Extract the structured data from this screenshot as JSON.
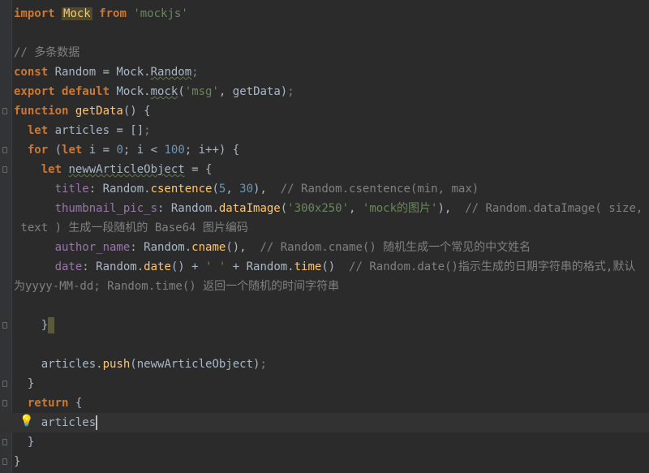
{
  "editor": {
    "lines": [
      [
        {
          "t": "import ",
          "c": "kw"
        },
        {
          "t": "Mock",
          "c": "mockhl"
        },
        {
          "t": " ",
          "c": ""
        },
        {
          "t": "from",
          "c": "kw"
        },
        {
          "t": " 'mockjs'",
          "c": "str"
        }
      ],
      [],
      [
        {
          "t": "// 多条数据",
          "c": "cm"
        }
      ],
      [
        {
          "t": "const ",
          "c": "kw"
        },
        {
          "t": "Random = Mock.",
          "c": ""
        },
        {
          "t": "Random",
          "c": "squig"
        },
        {
          "t": ";",
          "c": "cm"
        }
      ],
      [
        {
          "t": "export ",
          "c": "kw"
        },
        {
          "t": "default ",
          "c": "kw"
        },
        {
          "t": "Mock.",
          "c": ""
        },
        {
          "t": "mock",
          "c": "squig"
        },
        {
          "t": "(",
          "c": ""
        },
        {
          "t": "'msg'",
          "c": "str"
        },
        {
          "t": ", getData)",
          "c": ""
        },
        {
          "t": ";",
          "c": "cm"
        }
      ],
      [
        {
          "t": "function ",
          "c": "kw"
        },
        {
          "t": "getData",
          "c": "fn"
        },
        {
          "t": "() {",
          "c": ""
        }
      ],
      [
        {
          "t": "  let ",
          "c": "kw"
        },
        {
          "t": "articles = []",
          "c": ""
        },
        {
          "t": ";",
          "c": "cm"
        }
      ],
      [
        {
          "t": "  for ",
          "c": "kw"
        },
        {
          "t": "(",
          "c": ""
        },
        {
          "t": "let ",
          "c": "kw"
        },
        {
          "t": "i = ",
          "c": ""
        },
        {
          "t": "0",
          "c": "num"
        },
        {
          "t": "; i < ",
          "c": ""
        },
        {
          "t": "100",
          "c": "num"
        },
        {
          "t": "; i++) {",
          "c": ""
        }
      ],
      [
        {
          "t": "    let ",
          "c": "kw"
        },
        {
          "t": "newwArticleObject",
          "c": "squig"
        },
        {
          "t": " = {",
          "c": ""
        }
      ],
      [
        {
          "t": "      title",
          "c": "prop"
        },
        {
          "t": ": Random.",
          "c": ""
        },
        {
          "t": "csentence",
          "c": "fn"
        },
        {
          "t": "(",
          "c": ""
        },
        {
          "t": "5",
          "c": "num"
        },
        {
          "t": ", ",
          "c": ""
        },
        {
          "t": "30",
          "c": "num"
        },
        {
          "t": "),  ",
          "c": ""
        },
        {
          "t": "// Random.csentence(min, max)",
          "c": "cm"
        }
      ],
      [
        {
          "t": "      thumbnail_pic_s",
          "c": "prop"
        },
        {
          "t": ": Random.",
          "c": ""
        },
        {
          "t": "dataImage",
          "c": "fn"
        },
        {
          "t": "(",
          "c": ""
        },
        {
          "t": "'300x250'",
          "c": "str"
        },
        {
          "t": ", ",
          "c": ""
        },
        {
          "t": "'mock的图片'",
          "c": "str"
        },
        {
          "t": "),  ",
          "c": ""
        },
        {
          "t": "// Random.dataImage( size,",
          "c": "cm"
        }
      ],
      [
        {
          "t": " text ) 生成一段随机的 Base64 图片编码",
          "c": "cm"
        }
      ],
      [
        {
          "t": "      author_name",
          "c": "prop"
        },
        {
          "t": ": Random.",
          "c": ""
        },
        {
          "t": "cname",
          "c": "fn"
        },
        {
          "t": "(),  ",
          "c": ""
        },
        {
          "t": "// Random.cname() 随机生成一个常见的中文姓名",
          "c": "cm"
        }
      ],
      [
        {
          "t": "      date",
          "c": "prop"
        },
        {
          "t": ": Random.",
          "c": ""
        },
        {
          "t": "date",
          "c": "fn"
        },
        {
          "t": "() + ",
          "c": ""
        },
        {
          "t": "' '",
          "c": "str"
        },
        {
          "t": " + Random.",
          "c": ""
        },
        {
          "t": "time",
          "c": "fn"
        },
        {
          "t": "()  ",
          "c": ""
        },
        {
          "t": "// Random.date()指示生成的日期字符串的格式,默认",
          "c": "cm"
        }
      ],
      [
        {
          "t": "为yyyy-MM-dd; Random.time() 返回一个随机的时间字符串",
          "c": "cm"
        }
      ],
      [],
      [
        {
          "t": "    }",
          "c": ""
        },
        {
          "t": "",
          "c": "blockcaret"
        }
      ],
      [],
      [
        {
          "t": "    articles.",
          "c": ""
        },
        {
          "t": "push",
          "c": "fn"
        },
        {
          "t": "(newwArticleObject)",
          "c": ""
        },
        {
          "t": ";",
          "c": "cm"
        }
      ],
      [
        {
          "t": "  }",
          "c": ""
        }
      ],
      [
        {
          "t": "  return ",
          "c": "kw"
        },
        {
          "t": "{",
          "c": ""
        }
      ],
      [
        {
          "t": "    articles",
          "c": ""
        },
        {
          "t": "",
          "c": "caret"
        }
      ],
      [
        {
          "t": "  }",
          "c": ""
        }
      ],
      [
        {
          "t": "}",
          "c": ""
        }
      ]
    ],
    "current_line": 21
  }
}
